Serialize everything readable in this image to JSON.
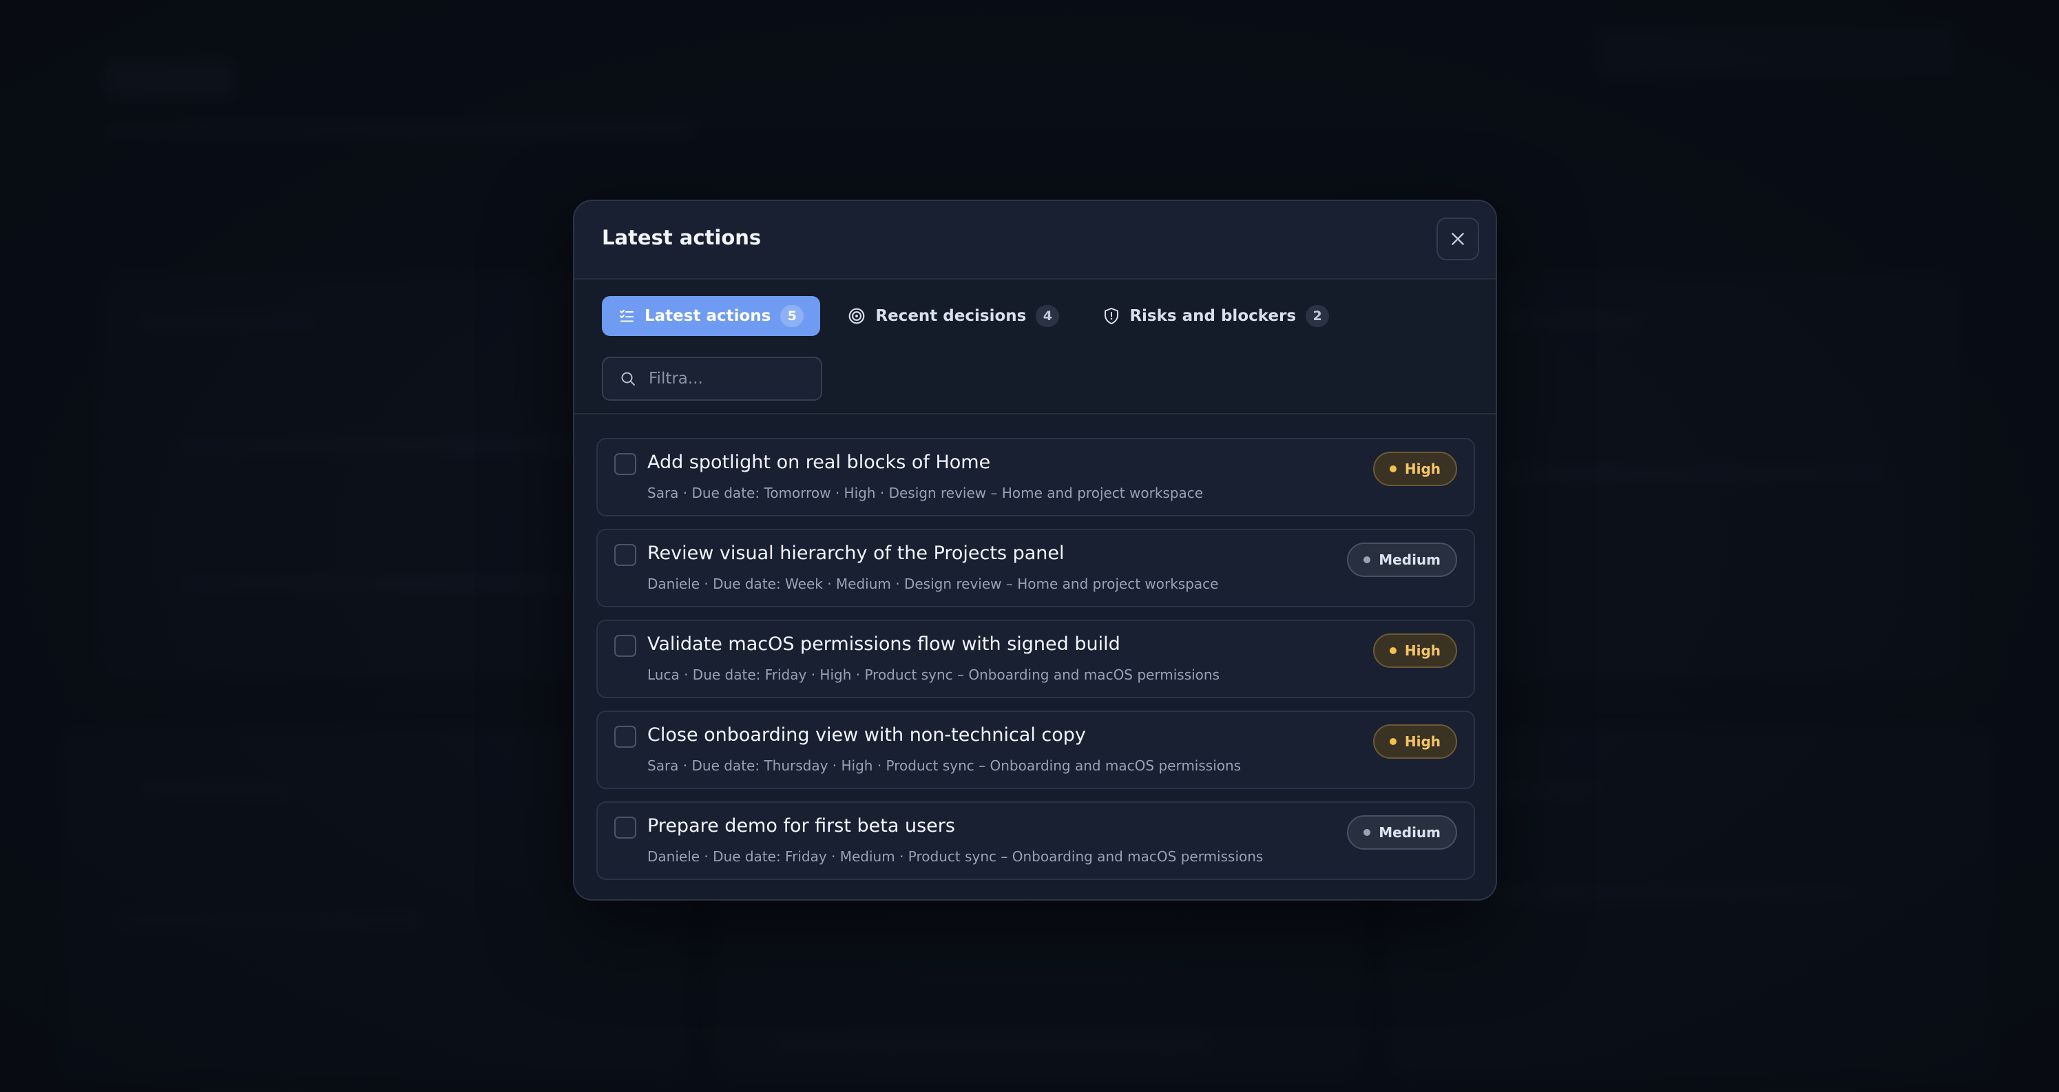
{
  "modal": {
    "title": "Latest actions",
    "tabs": [
      {
        "label": "Latest actions",
        "count": "5",
        "icon": "list-check-icon",
        "active": true
      },
      {
        "label": "Recent decisions",
        "count": "4",
        "icon": "target-icon",
        "active": false
      },
      {
        "label": "Risks and blockers",
        "count": "2",
        "icon": "shield-icon",
        "active": false
      }
    ],
    "search": {
      "placeholder": "Filtra..."
    },
    "items": [
      {
        "title": "Add spotlight on real blocks of Home",
        "meta": "Sara · Due date: Tomorrow · High · Design review – Home and project workspace",
        "priority": "High"
      },
      {
        "title": "Review visual hierarchy of the Projects panel",
        "meta": "Daniele · Due date: Week · Medium · Design review – Home and project workspace",
        "priority": "Medium"
      },
      {
        "title": "Validate macOS permissions flow with signed build",
        "meta": "Luca · Due date: Friday · High · Product sync – Onboarding and macOS permissions",
        "priority": "High"
      },
      {
        "title": "Close onboarding view with non-technical copy",
        "meta": "Sara · Due date: Thursday · High · Product sync – Onboarding and macOS permissions",
        "priority": "High"
      },
      {
        "title": "Prepare demo for first beta users",
        "meta": "Daniele · Due date: Friday · Medium · Product sync – Onboarding and macOS permissions",
        "priority": "Medium"
      }
    ]
  },
  "colors": {
    "accent": "#6f9cf2",
    "high": "#f5c46a",
    "medium": "#9aa3b5",
    "surface": "#151c2b"
  }
}
